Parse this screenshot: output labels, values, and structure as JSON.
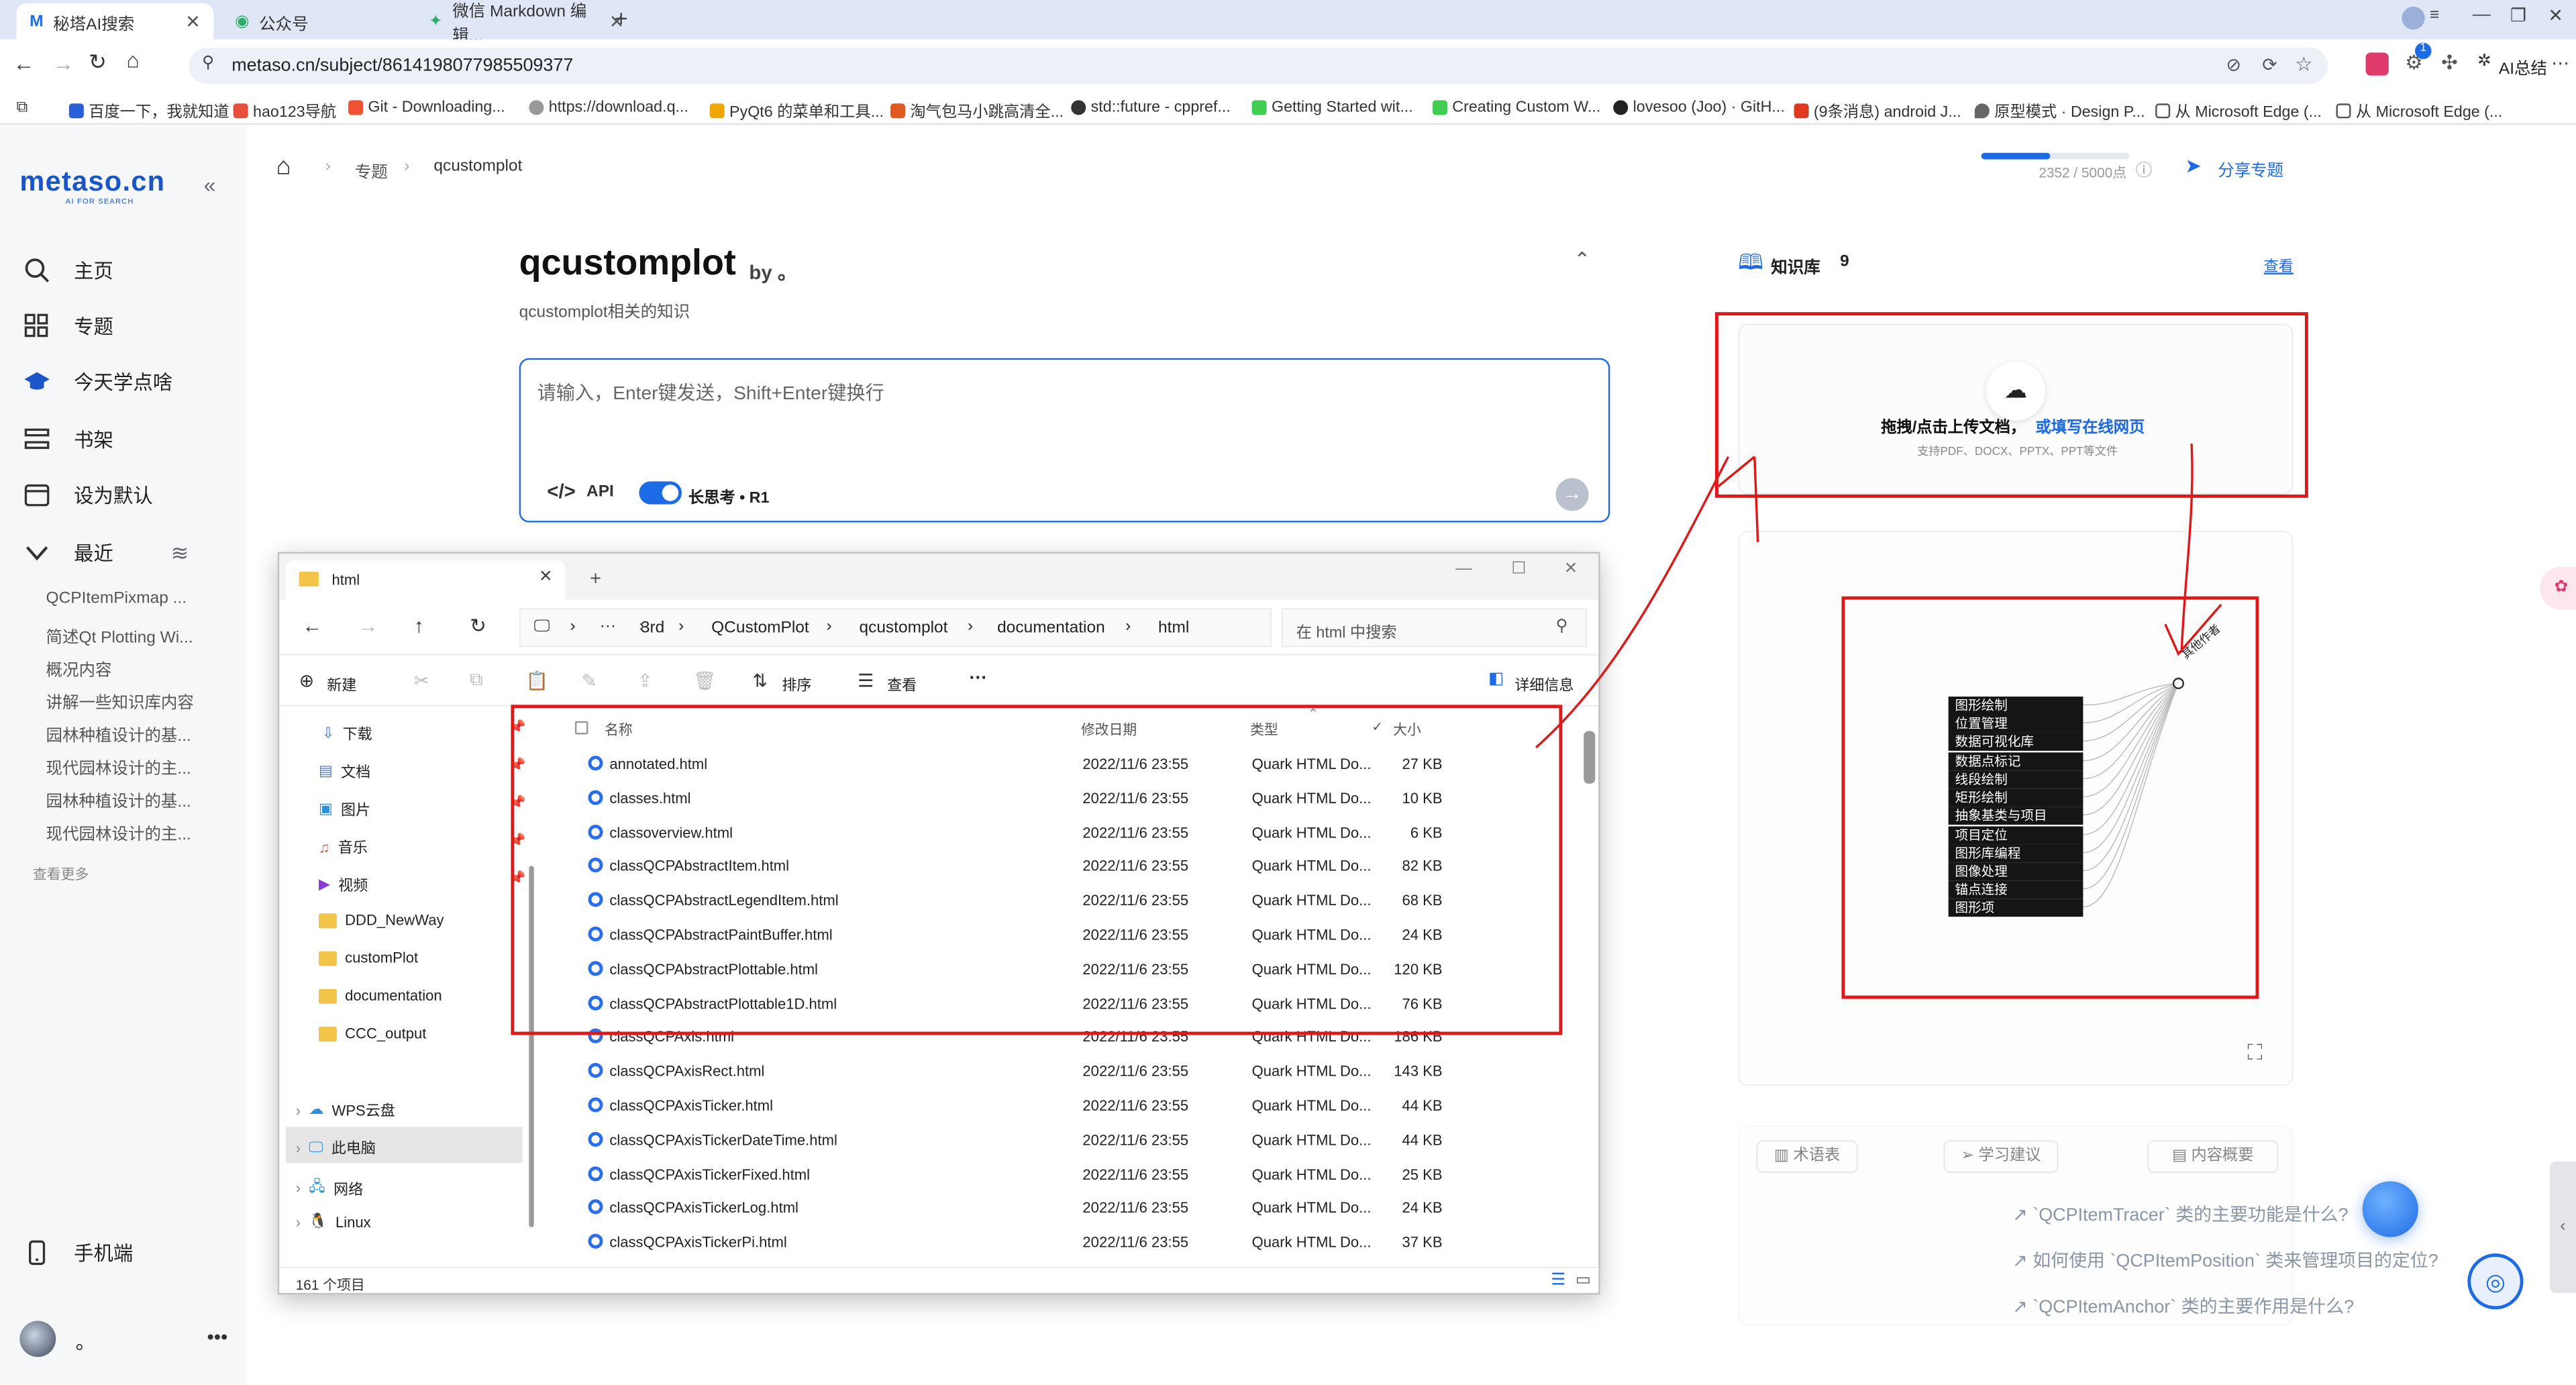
{
  "browser": {
    "tabs": [
      "秘塔AI搜索",
      "公众号",
      "微信 Markdown 编辑..."
    ],
    "new_tab": "+",
    "url": "metaso.cn/subject/8614198077985509377",
    "account": "AI总结",
    "badge": "1",
    "bookmarks": [
      "百度一下，我就知道",
      "hao123导航",
      "Git - Downloading...",
      "https://download.q...",
      "PyQt6 的菜单和工具...",
      "淘气包马小跳高清全...",
      "std::future - cppref...",
      "Getting Started wit...",
      "Creating Custom W...",
      "lovesoo (Joo) · GitH...",
      "(9条消息) android J...",
      "原型模式 · Design P...",
      "从 Microsoft Edge (...",
      "从 Microsoft Edge (..."
    ]
  },
  "sidebar": {
    "logo": "metaso.cn",
    "logo_sub": "AI FOR SEARCH",
    "nav": [
      "主页",
      "专题",
      "今天学点啥",
      "书架",
      "设为默认"
    ],
    "recent_label": "最近",
    "recent_items": [
      "QCPItemPixmap ...",
      "简述Qt Plotting Wi...",
      "概况内容",
      "讲解一些知识库内容",
      "园林种植设计的基...",
      "现代园林设计的主...",
      "园林种植设计的基...",
      "现代园林设计的主..."
    ],
    "more": "查看更多",
    "mobile": "手机端",
    "user": "。"
  },
  "header": {
    "breadcrumb": [
      "专题",
      "qcustomplot"
    ],
    "quota": "2352 / 5000点",
    "quota_fraction": 0.47,
    "share": "分享专题"
  },
  "subject": {
    "title": "qcustomplot",
    "by": "by 。",
    "desc": "qcustomplot相关的知识",
    "placeholder": "请输入，Enter键发送，Shift+Enter键换行",
    "api": "API",
    "toggle_label": "长思考 • R1"
  },
  "knowledge": {
    "label": "知识库",
    "count": "9",
    "view": "查看",
    "upload_title": "拖拽/点击上传文档，",
    "upload_link": "或填写在线网页",
    "upload_sub": "支持PDF、DOCX、PPTX、PPT等文件",
    "mindmap_root": "其他作者",
    "mindmap_items": [
      "图形绘制",
      "位置管理",
      "数据可视化库",
      "数据点标记",
      "线段绘制",
      "矩形绘制",
      "抽象基类与项目",
      "项目定位",
      "图形库编程",
      "图像处理",
      "锚点连接",
      "图形项"
    ],
    "tabs": [
      "术语表",
      "学习建议",
      "内容概要"
    ],
    "questions": [
      "`QCPItemTracer` 类的主要功能是什么?",
      "如何使用 `QCPItemPosition` 类来管理项目的定位?",
      "`QCPItemAnchor` 类的主要作用是什么?"
    ]
  },
  "explorer": {
    "tab_title": "html",
    "path": [
      "3rd",
      "QCustomPlot",
      "qcustomplot",
      "documentation",
      "html"
    ],
    "search_placeholder": "在 html 中搜索",
    "toolbar": {
      "new": "新建",
      "sort": "排序",
      "view": "查看",
      "details": "详细信息"
    },
    "columns": [
      "名称",
      "修改日期",
      "类型",
      "大小"
    ],
    "tree": [
      "下载",
      "文档",
      "图片",
      "音乐",
      "视频",
      "DDD_NewWay",
      "customPlot",
      "documentation",
      "CCC_output",
      "WPS云盘",
      "此电脑",
      "网络",
      "Linux"
    ],
    "files": [
      {
        "name": "annotated.html",
        "date": "2022/11/6 23:55",
        "type": "Quark HTML Do...",
        "size": "27 KB"
      },
      {
        "name": "classes.html",
        "date": "2022/11/6 23:55",
        "type": "Quark HTML Do...",
        "size": "10 KB"
      },
      {
        "name": "classoverview.html",
        "date": "2022/11/6 23:55",
        "type": "Quark HTML Do...",
        "size": "6 KB"
      },
      {
        "name": "classQCPAbstractItem.html",
        "date": "2022/11/6 23:55",
        "type": "Quark HTML Do...",
        "size": "82 KB"
      },
      {
        "name": "classQCPAbstractLegendItem.html",
        "date": "2022/11/6 23:55",
        "type": "Quark HTML Do...",
        "size": "68 KB"
      },
      {
        "name": "classQCPAbstractPaintBuffer.html",
        "date": "2022/11/6 23:55",
        "type": "Quark HTML Do...",
        "size": "24 KB"
      },
      {
        "name": "classQCPAbstractPlottable.html",
        "date": "2022/11/6 23:55",
        "type": "Quark HTML Do...",
        "size": "120 KB"
      },
      {
        "name": "classQCPAbstractPlottable1D.html",
        "date": "2022/11/6 23:55",
        "type": "Quark HTML Do...",
        "size": "76 KB"
      },
      {
        "name": "classQCPAxis.html",
        "date": "2022/11/6 23:55",
        "type": "Quark HTML Do...",
        "size": "186 KB"
      },
      {
        "name": "classQCPAxisRect.html",
        "date": "2022/11/6 23:55",
        "type": "Quark HTML Do...",
        "size": "143 KB"
      },
      {
        "name": "classQCPAxisTicker.html",
        "date": "2022/11/6 23:55",
        "type": "Quark HTML Do...",
        "size": "44 KB"
      },
      {
        "name": "classQCPAxisTickerDateTime.html",
        "date": "2022/11/6 23:55",
        "type": "Quark HTML Do...",
        "size": "44 KB"
      },
      {
        "name": "classQCPAxisTickerFixed.html",
        "date": "2022/11/6 23:55",
        "type": "Quark HTML Do...",
        "size": "25 KB"
      },
      {
        "name": "classQCPAxisTickerLog.html",
        "date": "2022/11/6 23:55",
        "type": "Quark HTML Do...",
        "size": "24 KB"
      },
      {
        "name": "classQCPAxisTickerPi.html",
        "date": "2022/11/6 23:55",
        "type": "Quark HTML Do...",
        "size": "37 KB"
      }
    ],
    "status": "161 个项目"
  },
  "colors": {
    "accent": "#1e6be6",
    "annotation": "#e01818"
  }
}
